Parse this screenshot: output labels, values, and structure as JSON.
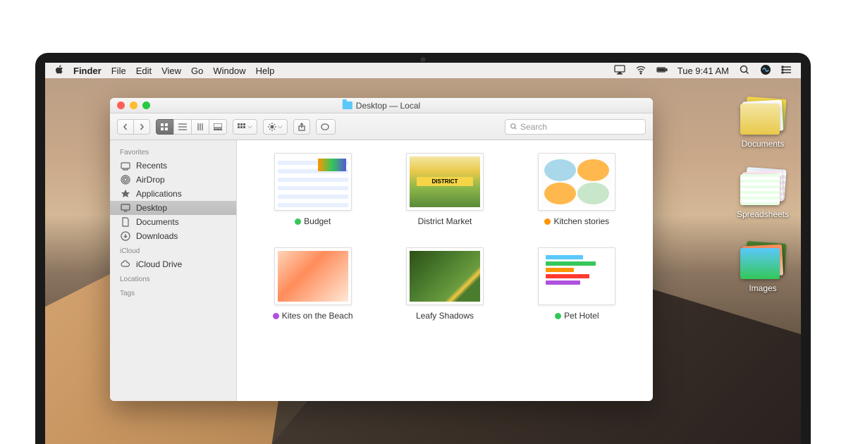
{
  "menubar": {
    "app": "Finder",
    "items": [
      "File",
      "Edit",
      "View",
      "Go",
      "Window",
      "Help"
    ],
    "clock": "Tue 9:41 AM"
  },
  "window": {
    "title": "Desktop — Local",
    "search_placeholder": "Search"
  },
  "sidebar": {
    "sections": [
      {
        "title": "Favorites",
        "items": [
          "Recents",
          "AirDrop",
          "Applications",
          "Desktop",
          "Documents",
          "Downloads"
        ],
        "selected": "Desktop"
      },
      {
        "title": "iCloud",
        "items": [
          "iCloud Drive"
        ]
      },
      {
        "title": "Locations",
        "items": []
      },
      {
        "title": "Tags",
        "items": []
      }
    ]
  },
  "files": [
    {
      "name": "Budget",
      "tag": "green"
    },
    {
      "name": "District Market",
      "tag": null
    },
    {
      "name": "Kitchen stories",
      "tag": "orange"
    },
    {
      "name": "Kites on the Beach",
      "tag": "purple"
    },
    {
      "name": "Leafy Shadows",
      "tag": null
    },
    {
      "name": "Pet Hotel",
      "tag": "green"
    }
  ],
  "stacks": [
    {
      "label": "Documents"
    },
    {
      "label": "Spreadsheets"
    },
    {
      "label": "Images"
    }
  ]
}
